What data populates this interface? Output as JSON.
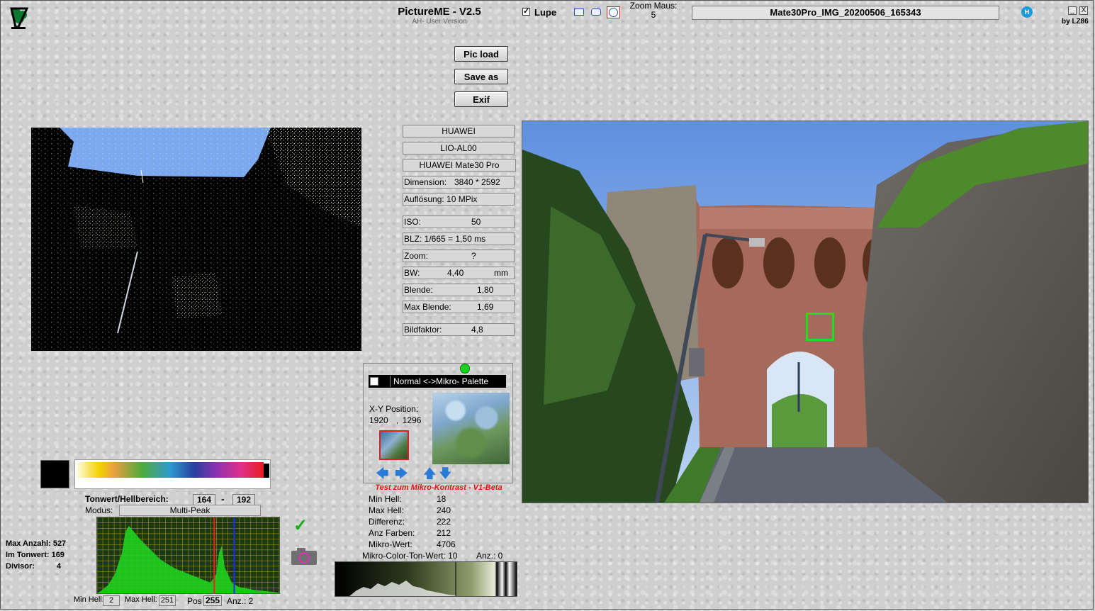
{
  "header": {
    "title": "PictureME - V2.5",
    "subtitle": "AH- User Version",
    "lupe_label": "Lupe",
    "lupe_checked": true,
    "zoom_label": "Zoom Maus:",
    "zoom_value": "5",
    "filename": "Mate30Pro_IMG_20200506_165343",
    "info_icon_text": "H",
    "minimize_label": "_",
    "close_label": "X",
    "credit": "by LZ86"
  },
  "buttons": {
    "pic_load": "Pic load",
    "save_as": "Save as",
    "exif": "Exif"
  },
  "exif": {
    "make": "HUAWEI",
    "model_code": "LIO-AL00",
    "model_name": "HUAWEI Mate30 Pro",
    "dimension_label": "Dimension:",
    "dimension_value": "3840 * 2592",
    "aufloesung": "Auflösung: 10 MPix",
    "iso_label": "ISO:",
    "iso_value": "50",
    "blz": "BLZ: 1/665 = 1,50 ms",
    "zoom_label": "Zoom:",
    "zoom_value": "?",
    "bw_label": "BW:",
    "bw_value": "4,40",
    "bw_unit": "mm",
    "blende_label": "Blende:",
    "blende_value": "1,80",
    "max_blende_label": "Max Blende:",
    "max_blende_value": "1,69",
    "bildfaktor_label": "Bildfaktor:",
    "bildfaktor_value": "4,8"
  },
  "micro": {
    "palette_label": "Normal <->Mikro- Palette",
    "palette_checked": false,
    "xy_label": "X-Y Position:",
    "x": "1920",
    "separator": ",",
    "y": "1296",
    "arrows": {
      "left": "🡄",
      "right": "🡆",
      "up": "🡅",
      "down": "🡇"
    },
    "caption": "Test zum Mikro-Kontrast - V1-Beta",
    "stats": [
      {
        "label": "Min Hell:",
        "value": "18"
      },
      {
        "label": "Max Hell:",
        "value": "240"
      },
      {
        "label": "Differenz:",
        "value": "222"
      },
      {
        "label": "Anz Farben:",
        "value": "212"
      },
      {
        "label": "Mikro-Wert:",
        "value": "4706"
      }
    ],
    "mct_label": "Mikro-Color-Ton-Wert: 10",
    "anz_label": "Anz.:  0"
  },
  "tonwert": {
    "label": "Tonwert/Hellbereich:",
    "min": "164",
    "dash": "-",
    "max": "192",
    "modus_label": "Modus:",
    "modus_value": "Multi-Peak"
  },
  "histogram": {
    "max_anzahl": "Max Anzahl: 527",
    "im_tonwert": "Im Tonwert: 169",
    "divisor_label": "Divisor:",
    "divisor_value": "4",
    "min_hell_label": "Min Hell:",
    "min_hell_value": "2",
    "max_hell_label": "Max Hell:",
    "max_hell_value": "251",
    "pos_label": "Pos",
    "pos_value": "255",
    "anz_label": "Anz.: 2",
    "red_marker": 164,
    "blue_marker": 192,
    "colors": {
      "fill": "#1fd11f",
      "grid": "#c8a000",
      "red": "#ff1a1a",
      "blue": "#1a2aff"
    }
  },
  "icons": {
    "logo": "tree-logo-icon",
    "check": "check-icon",
    "camera": "camera-icon",
    "info": "info-icon"
  }
}
